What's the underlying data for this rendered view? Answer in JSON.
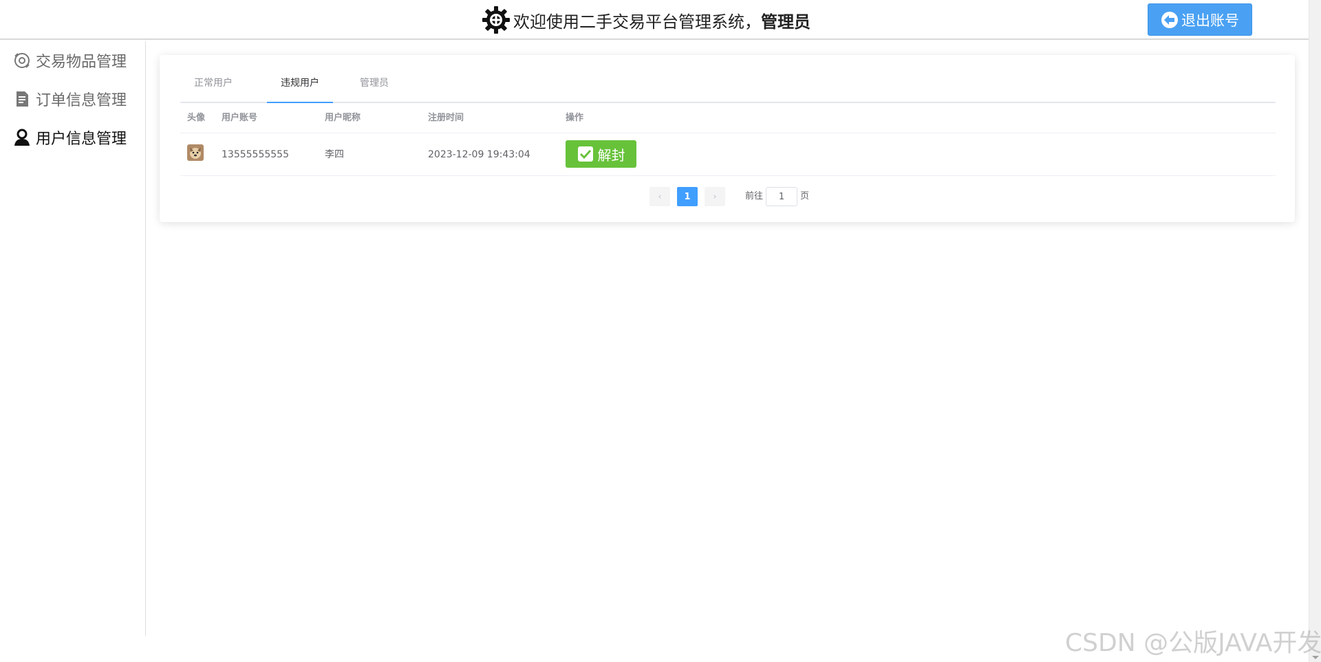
{
  "header": {
    "title": "欢迎使用二手交易平台管理系统，",
    "role": "管理员",
    "logout_label": "退出账号"
  },
  "sidebar": {
    "items": [
      {
        "label": "交易物品管理",
        "icon": "goods-icon",
        "active": false
      },
      {
        "label": "订单信息管理",
        "icon": "order-icon",
        "active": false
      },
      {
        "label": "用户信息管理",
        "icon": "user-icon",
        "active": true
      }
    ]
  },
  "tabs": [
    {
      "label": "正常用户",
      "active": false
    },
    {
      "label": "违规用户",
      "active": true
    },
    {
      "label": "管理员",
      "active": false
    }
  ],
  "table": {
    "columns": [
      "头像",
      "用户账号",
      "用户昵称",
      "注册时间",
      "操作"
    ],
    "rows": [
      {
        "avatar": "dog-avatar",
        "account": "13555555555",
        "nickname": "李四",
        "register_time": "2023-12-09 19:43:04",
        "action_label": "解封"
      }
    ]
  },
  "pagination": {
    "prev": "‹",
    "current": "1",
    "next": "›",
    "goto_prefix": "前往",
    "goto_value": "1",
    "goto_suffix": "页"
  },
  "watermark": "CSDN @公版JAVA开发",
  "colors": {
    "primary": "#409eff",
    "logout_button": "#4aa1f3",
    "success": "#67c23a",
    "tab_active_bar": "#409eff"
  }
}
